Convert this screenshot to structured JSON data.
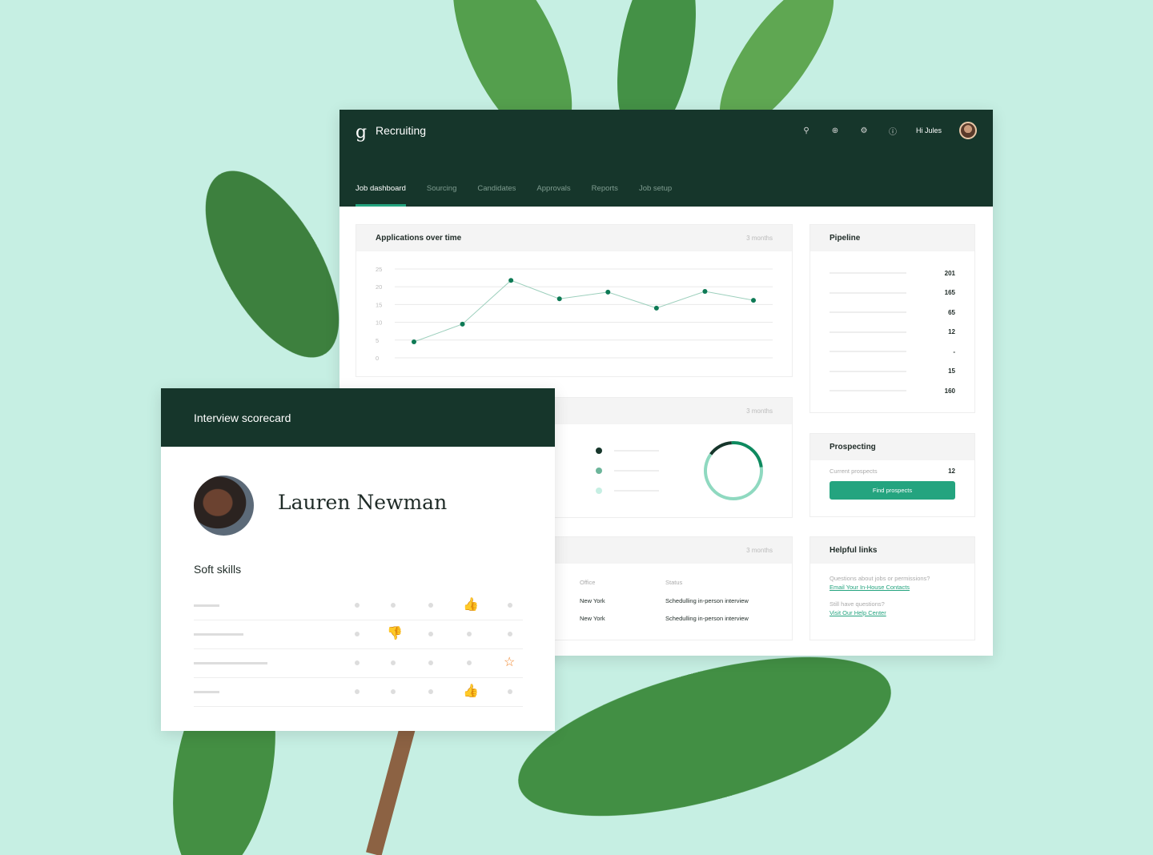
{
  "app": {
    "title": "Recruiting",
    "greeting": "Hi Jules",
    "icons": [
      "search-icon",
      "add-icon",
      "settings-icon",
      "help-icon"
    ]
  },
  "tabs": [
    {
      "label": "Job dashboard",
      "active": true
    },
    {
      "label": "Sourcing"
    },
    {
      "label": "Candidates"
    },
    {
      "label": "Approvals"
    },
    {
      "label": "Reports"
    },
    {
      "label": "Job setup"
    }
  ],
  "applications": {
    "title": "Applications over time",
    "period": "3 months"
  },
  "chart_data": {
    "type": "line",
    "title": "Applications over time",
    "y_ticks": [
      0,
      5,
      10,
      15,
      20,
      25
    ],
    "ylim": [
      0,
      25
    ],
    "grid": true,
    "values": [
      4.5,
      9.5,
      21.8,
      16.6,
      18.5,
      14,
      18.7,
      16.2
    ],
    "color": "#0e7a55"
  },
  "donut": {
    "period": "3 months",
    "segments": [
      {
        "share": 0.14,
        "color": "#16362b"
      },
      {
        "share": 0.24,
        "color": "#0e8a5f"
      },
      {
        "share": 0.62,
        "color": "#8fd9c0"
      }
    ]
  },
  "table": {
    "period": "3 months",
    "headers": [
      "Office",
      "Status"
    ],
    "rows": [
      [
        "New York",
        "Schedulling in-person interview"
      ],
      [
        "New York",
        "Schedulling in-person interview"
      ]
    ]
  },
  "pipeline": {
    "title": "Pipeline",
    "values": [
      "201",
      "165",
      "65",
      "12",
      "-",
      "15",
      "160"
    ]
  },
  "prospecting": {
    "title": "Prospecting",
    "label": "Current prospects",
    "count": "12",
    "button": "Find prospects"
  },
  "helpful": {
    "title": "Helpful links",
    "q1": "Questions about jobs or permissions?",
    "link1": "Email Your In-House Contacts",
    "q2": "Still have questions?",
    "link2": "Visit Our Help Center"
  },
  "scorecard": {
    "title": "Interview scorecard",
    "candidate": "Lauren Newman",
    "section": "Soft skills",
    "rows": [
      {
        "rating": 4,
        "icon": "thumbs-up"
      },
      {
        "rating": 2,
        "icon": "thumbs-down"
      },
      {
        "rating": 5,
        "icon": "star"
      },
      {
        "rating": 4,
        "icon": "thumbs-up"
      }
    ],
    "colors": {
      "thumbs-up": "#0e8a5f",
      "thumbs-down": "#d6404a",
      "star": "#f0872e"
    }
  }
}
